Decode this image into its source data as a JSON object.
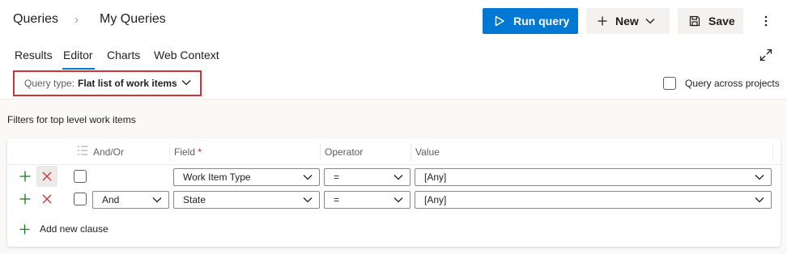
{
  "breadcrumb": {
    "root": "Queries",
    "separator": "›",
    "current": "My Queries"
  },
  "toolbar": {
    "run_label": "Run query",
    "new_label": "New",
    "save_label": "Save"
  },
  "tabs": [
    {
      "label": "Results"
    },
    {
      "label": "Editor",
      "active": true
    },
    {
      "label": "Charts"
    },
    {
      "label": "Web Context"
    }
  ],
  "query_type": {
    "prefix": "Query type:",
    "value": "Flat list of work items"
  },
  "query_across_projects": {
    "label": "Query across projects",
    "checked": false
  },
  "filters_title": "Filters for top level work items",
  "columns": {
    "and_or": "And/Or",
    "field": "Field",
    "required_mark": "*",
    "operator": "Operator",
    "value": "Value"
  },
  "clauses": [
    {
      "and_or": "",
      "field": "Work Item Type",
      "operator": "=",
      "value": "[Any]"
    },
    {
      "and_or": "And",
      "field": "State",
      "operator": "=",
      "value": "[Any]"
    }
  ],
  "add_clause_label": "Add new clause",
  "colors": {
    "accent": "#0078d4",
    "add_green": "#107c10",
    "delete_red": "#d13438",
    "highlight_border": "#d13438"
  }
}
